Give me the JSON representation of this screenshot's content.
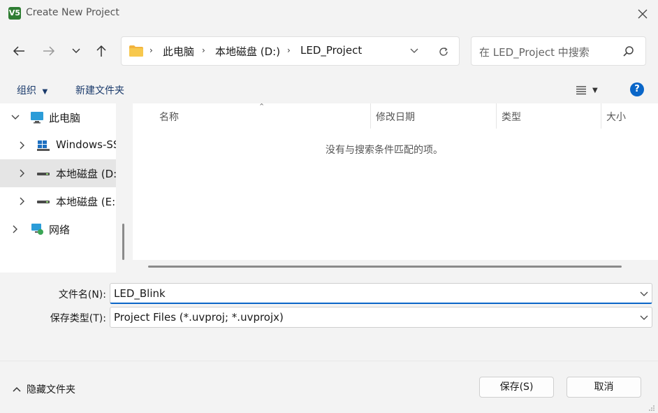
{
  "window": {
    "title": "Create New Project",
    "app_icon_text": "V5"
  },
  "address": {
    "crumbs": [
      "此电脑",
      "本地磁盘 (D:)",
      "LED_Project"
    ]
  },
  "search": {
    "placeholder": "在 LED_Project 中搜索"
  },
  "toolbar": {
    "organize_label": "组织",
    "new_folder_label": "新建文件夹",
    "help_label": "?"
  },
  "nav_pane": {
    "items": [
      {
        "label": "此电脑",
        "icon": "computer-icon",
        "expanded": true
      },
      {
        "label": "Windows-SSD",
        "icon": "windows-drive-icon"
      },
      {
        "label": "本地磁盘 (D:)",
        "icon": "drive-icon",
        "selected": true
      },
      {
        "label": "本地磁盘 (E:)",
        "icon": "drive-icon"
      },
      {
        "label": "网络",
        "icon": "network-icon"
      }
    ]
  },
  "file_list": {
    "columns": [
      "名称",
      "修改日期",
      "类型",
      "大小"
    ],
    "empty_message": "没有与搜索条件匹配的项。"
  },
  "form": {
    "filename_label": "文件名(N):",
    "filename_value": "LED_Blink",
    "filetype_label": "保存类型(T):",
    "filetype_value": "Project Files (*.uvproj; *.uvprojx)"
  },
  "footer": {
    "hide_folders_label": "隐藏文件夹",
    "save_label": "保存(S)",
    "cancel_label": "取消"
  },
  "colors": {
    "accent": "#0a66c8",
    "folder": "#f2b33d",
    "selected_bg": "#e5e5e5"
  }
}
